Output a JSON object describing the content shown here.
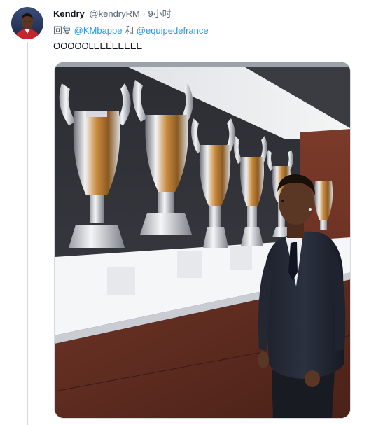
{
  "tweet": {
    "author_name": "Kendry",
    "author_handle": "@kendryRM",
    "separator": "·",
    "time": "9小时",
    "reply_prefix": "回复",
    "reply_mention_1": "@KMbappe",
    "reply_and": "和",
    "reply_mention_2": "@equipedefrance",
    "text": "OOOOOLEEEEEEEE"
  },
  "colors": {
    "link": "#1d9bf0",
    "secondary_text": "#536471",
    "primary_text": "#0f1419",
    "thread_line": "#cfd9de"
  }
}
